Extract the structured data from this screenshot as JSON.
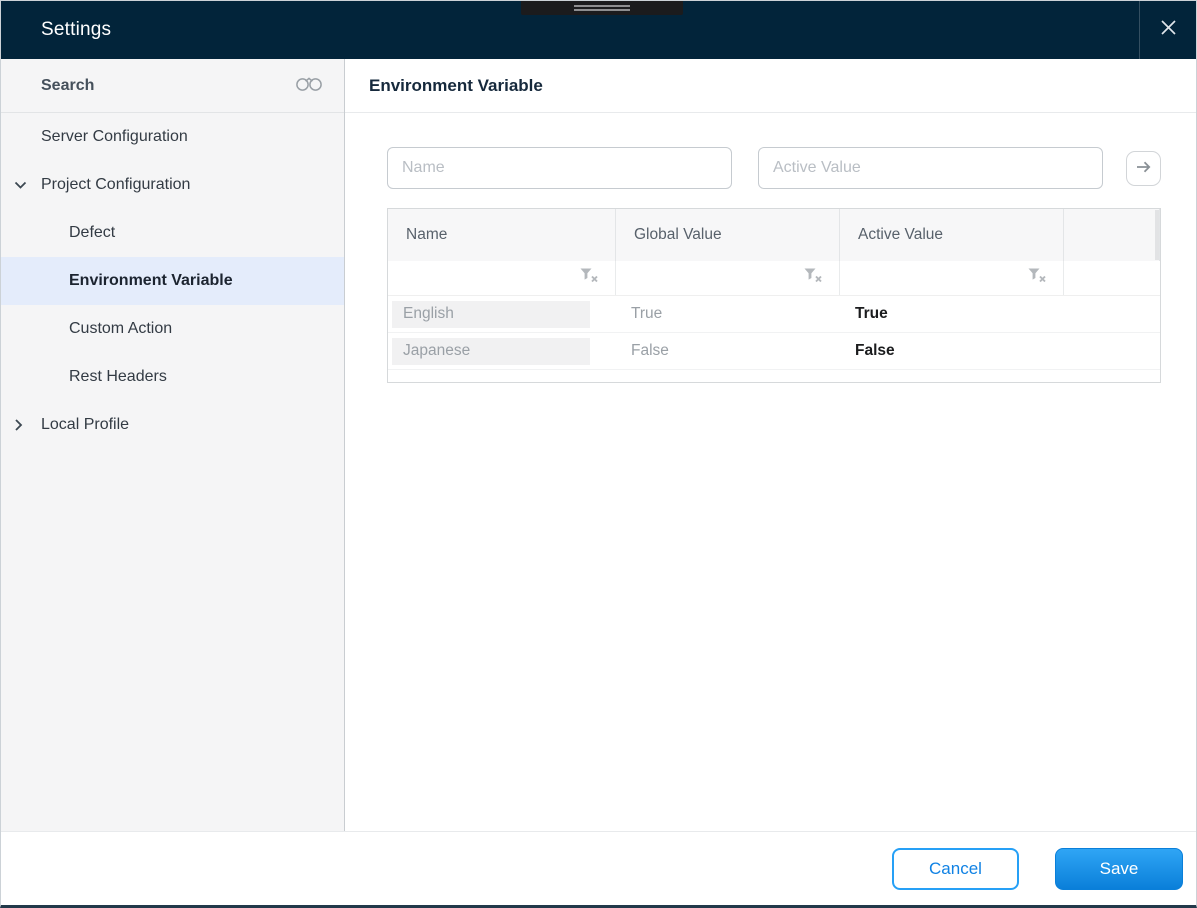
{
  "dialog": {
    "title": "Settings"
  },
  "sidebar": {
    "search_label": "Search",
    "items": [
      {
        "label": "Server Configuration"
      },
      {
        "label": "Project Configuration"
      },
      {
        "label": "Defect"
      },
      {
        "label": "Environment Variable"
      },
      {
        "label": "Custom Action"
      },
      {
        "label": "Rest Headers"
      },
      {
        "label": "Local Profile"
      }
    ]
  },
  "main": {
    "title": "Environment Variable",
    "form": {
      "name_placeholder": "Name",
      "active_value_placeholder": "Active Value"
    },
    "table": {
      "columns": [
        "Name",
        "Global Value",
        "Active Value",
        ""
      ],
      "rows": [
        {
          "name": "English",
          "global_value": "True",
          "active_value": "True"
        },
        {
          "name": "Japanese",
          "global_value": "False",
          "active_value": "False"
        }
      ]
    }
  },
  "footer": {
    "cancel_label": "Cancel",
    "save_label": "Save"
  },
  "colors": {
    "header_bg": "#02243a",
    "accent_blue": "#1493ea",
    "selected_item_bg": "#e4ecfb"
  }
}
